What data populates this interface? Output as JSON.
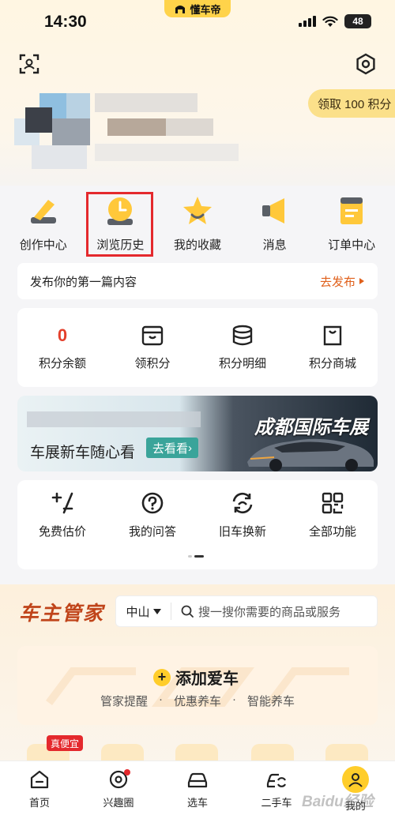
{
  "status_bar": {
    "time": "14:30",
    "brand": "懂车帝",
    "battery": "48"
  },
  "header": {
    "points_button": "领取 100 积分"
  },
  "quick_actions": [
    {
      "label": "创作中心",
      "icon": "pen-icon"
    },
    {
      "label": "浏览历史",
      "icon": "clock-icon"
    },
    {
      "label": "我的收藏",
      "icon": "star-icon"
    },
    {
      "label": "消息",
      "icon": "megaphone-icon"
    },
    {
      "label": "订单中心",
      "icon": "order-icon"
    }
  ],
  "publish_bar": {
    "text": "发布你的第一篇内容",
    "action": "去发布"
  },
  "points": [
    {
      "value": "0",
      "label": "积分余额"
    },
    {
      "label": "领积分",
      "icon": "gift-box-icon"
    },
    {
      "label": "积分明细",
      "icon": "coin-stack-icon"
    },
    {
      "label": "积分商城",
      "icon": "shopping-bag-icon"
    }
  ],
  "banner": {
    "title": "车展新车随心看",
    "button": "去看看",
    "event": "成都国际车展"
  },
  "tools": [
    {
      "label": "免费估价",
      "icon": "estimate-icon"
    },
    {
      "label": "我的问答",
      "icon": "question-icon"
    },
    {
      "label": "旧车换新",
      "icon": "trade-in-icon"
    },
    {
      "label": "全部功能",
      "icon": "grid-icon"
    }
  ],
  "owner": {
    "logo": "车主管家",
    "city": "中山",
    "search_placeholder": "搜一搜你需要的商品或服务",
    "add_car": "添加爱车",
    "features": [
      "管家提醒",
      "·",
      "优惠养车",
      "·",
      "智能养车"
    ],
    "tag": "真便宜"
  },
  "tabbar": [
    {
      "label": "首页",
      "icon": "home-icon"
    },
    {
      "label": "兴趣圈",
      "icon": "interest-icon"
    },
    {
      "label": "选车",
      "icon": "car-icon"
    },
    {
      "label": "二手车",
      "icon": "used-car-icon"
    },
    {
      "label": "我的",
      "icon": "profile-icon"
    }
  ],
  "watermark": "Baidu经验",
  "colors": {
    "accent": "#ffcd2a",
    "highlight": "#e4292d",
    "publish": "#e0601b"
  }
}
